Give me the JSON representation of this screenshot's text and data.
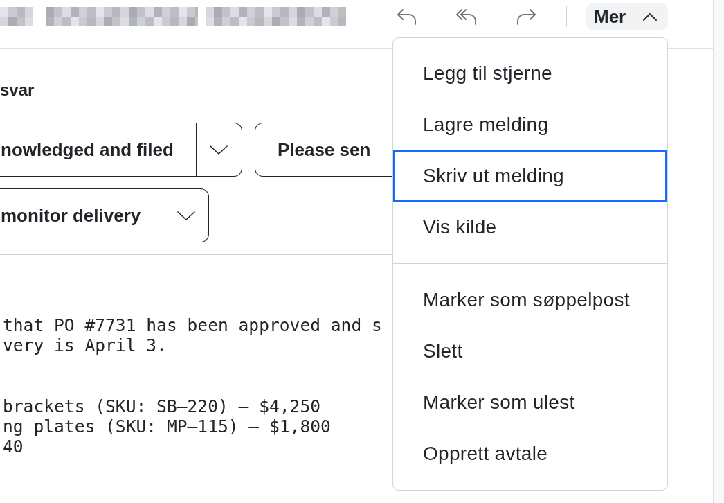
{
  "toolbar": {
    "more_button": {
      "label": "Mer",
      "expanded": true
    }
  },
  "more_menu": {
    "sections": [
      {
        "items": [
          {
            "label": "Legg til stjerne",
            "focused": false
          },
          {
            "label": "Lagre melding",
            "focused": false
          },
          {
            "label": "Skriv ut melding",
            "focused": true
          },
          {
            "label": "Vis kilde",
            "focused": false
          }
        ]
      },
      {
        "items": [
          {
            "label": "Marker som søppelpost",
            "focused": false
          },
          {
            "label": "Slett",
            "focused": false
          },
          {
            "label": "Marker som ulest",
            "focused": false
          },
          {
            "label": "Opprett avtale",
            "focused": false
          }
        ]
      }
    ]
  },
  "quick_replies": {
    "title": "svar",
    "rows": [
      [
        {
          "label": "nowledged and filed",
          "kind": "split"
        },
        {
          "label": "Please sen",
          "kind": "plain"
        }
      ],
      [
        {
          "label": "monitor delivery",
          "kind": "split"
        }
      ]
    ]
  },
  "message_body": {
    "paragraphs": [
      [
        "that PO #7731 has been approved and s",
        "very is April 3."
      ],
      [
        "brackets (SKU: SB–220) – $4,250",
        "ng plates (SKU: MP–115) – $1,800",
        "40"
      ]
    ]
  }
}
